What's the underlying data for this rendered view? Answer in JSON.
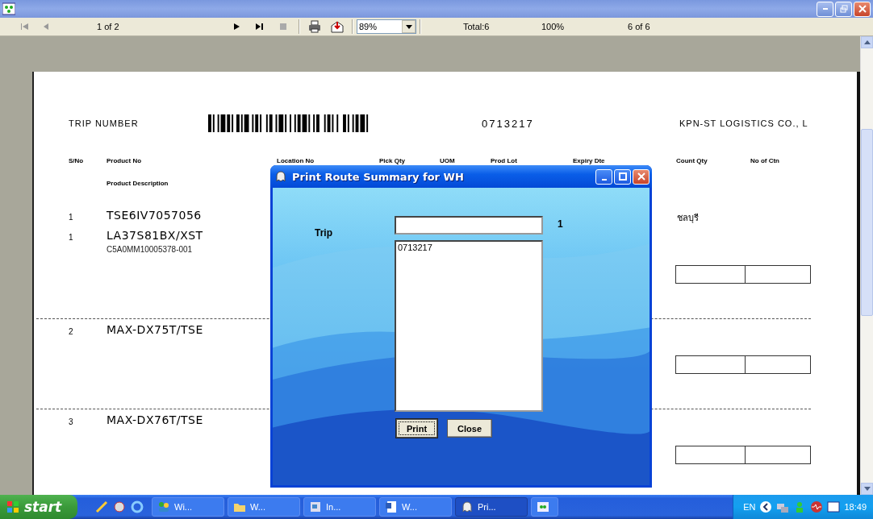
{
  "toolbar": {
    "page": "1 of 2",
    "zoom": "89%",
    "total": "Total:6",
    "percent": "100%",
    "records": "6 of 6"
  },
  "report": {
    "trip_label": "TRIP NUMBER",
    "trip_number": "0713217",
    "company": "KPN-ST LOGISTICS CO., L",
    "columns": [
      "S/No",
      "Product No",
      "Location No",
      "Pick Qty",
      "UOM",
      "Prod Lot",
      "Expiry Dte",
      "Count Qty",
      "No of Ctn"
    ],
    "subheader": "Product Description",
    "sections": [
      {
        "lines": [
          {
            "sno": "1",
            "product_no": "TSE6IV7057056",
            "place": "ชลบุรี"
          },
          {
            "sno": "1",
            "product_no": "LA37S81BX/XST",
            "description": "C5A0MM10005378-001"
          }
        ]
      },
      {
        "lines": [
          {
            "sno": "2",
            "product_no": "MAX-DX75T/TSE"
          }
        ]
      },
      {
        "lines": [
          {
            "sno": "3",
            "product_no": "MAX-DX76T/TSE"
          }
        ]
      }
    ]
  },
  "dialog": {
    "title": "Print Route Summary for WH",
    "trip_label": "Trip",
    "count": "1",
    "list": [
      "0713217"
    ],
    "buttons": [
      {
        "label": "Print",
        "focused": true
      },
      {
        "label": "Close",
        "focused": false
      }
    ]
  },
  "taskbar": {
    "start": "start",
    "tasks": [
      {
        "label": "Wi...",
        "kind": "people",
        "selected": false
      },
      {
        "label": "W...",
        "kind": "folder",
        "selected": false
      },
      {
        "label": "In...",
        "kind": "doc",
        "selected": false
      },
      {
        "label": "W...",
        "kind": "word",
        "selected": false
      },
      {
        "label": "Pri...",
        "kind": "ghost",
        "selected": true
      },
      {
        "kind": "report",
        "selected": false
      }
    ],
    "language": "EN",
    "clock": "18:49"
  }
}
